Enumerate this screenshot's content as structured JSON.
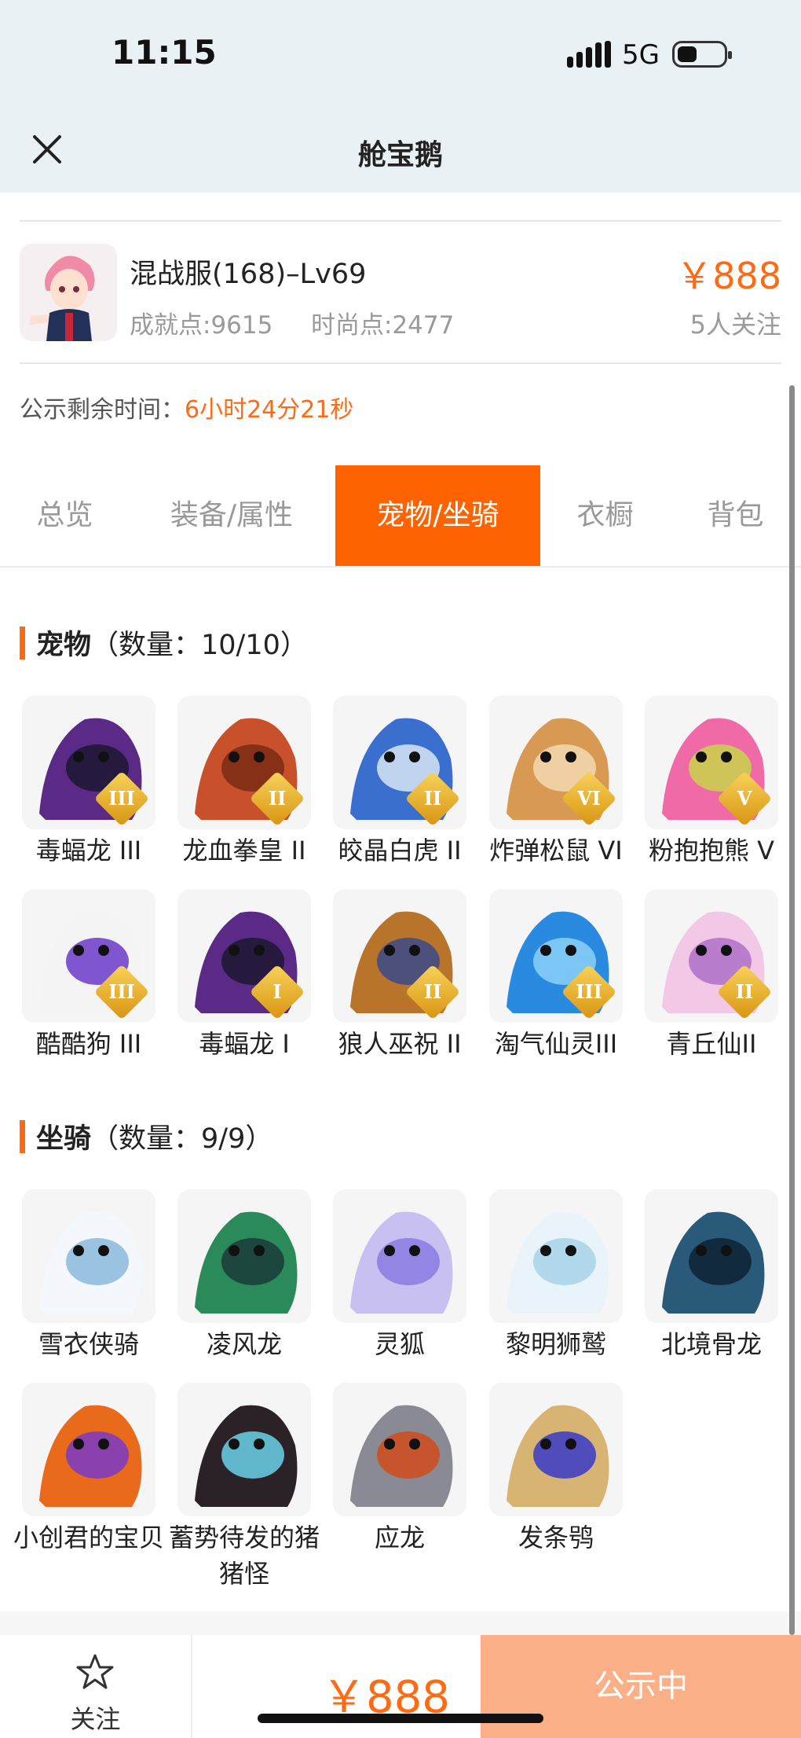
{
  "status_bar": {
    "time": "11:15",
    "network": "5G"
  },
  "nav": {
    "title": "舱宝鹅"
  },
  "listing": {
    "title": "混战服(168)–Lv69",
    "achievement": "成就点:9615",
    "fashion": "时尚点:2477",
    "price": "￥888",
    "followers": "5人关注"
  },
  "countdown": {
    "label": "公示剩余时间：",
    "value": "6小时24分21秒"
  },
  "tabs": [
    {
      "label": "总览"
    },
    {
      "label": "装备/属性"
    },
    {
      "label": "宠物/坐骑",
      "active": true
    },
    {
      "label": "衣橱"
    },
    {
      "label": "背包"
    }
  ],
  "pets_section": {
    "title": "宠物",
    "count": "（数量：10/10）"
  },
  "pets": [
    {
      "name": "毒蝠龙 III",
      "badge": "III",
      "colors": [
        "#5a2a86",
        "#1c1630"
      ]
    },
    {
      "name": "龙血拳皇 II",
      "badge": "II",
      "colors": [
        "#c8502a",
        "#7a2a14"
      ]
    },
    {
      "name": "皎晶白虎 II",
      "badge": "II",
      "colors": [
        "#3a6fd0",
        "#d8e6f6"
      ]
    },
    {
      "name": "炸弹松鼠 VI",
      "badge": "VI",
      "colors": [
        "#d89a52",
        "#f4d9b0"
      ]
    },
    {
      "name": "粉抱抱熊 V",
      "badge": "V",
      "colors": [
        "#f06aa8",
        "#c8d44a"
      ]
    },
    {
      "name": "酷酷狗 III",
      "badge": "III",
      "colors": [
        "#f4f4f4",
        "#6a3ac8"
      ]
    },
    {
      "name": "毒蝠龙 I",
      "badge": "I",
      "colors": [
        "#5a2a86",
        "#1c1630"
      ]
    },
    {
      "name": "狼人巫祝 II",
      "badge": "II",
      "colors": [
        "#b8742a",
        "#3a4a8a"
      ]
    },
    {
      "name": "淘气仙灵III",
      "badge": "III",
      "colors": [
        "#2a8ae0",
        "#8ad0f8"
      ]
    },
    {
      "name": "青丘仙II",
      "badge": "II",
      "colors": [
        "#f2c8e6",
        "#b070c8"
      ]
    }
  ],
  "mounts_section": {
    "title": "坐骑",
    "count": "（数量：9/9）"
  },
  "mounts": [
    {
      "name": "雪衣侠骑",
      "colors": [
        "#f4f8fc",
        "#8ab8dc"
      ]
    },
    {
      "name": "凌风龙",
      "colors": [
        "#2a8a5a",
        "#1a3a3a"
      ]
    },
    {
      "name": "灵狐",
      "colors": [
        "#c8c0f0",
        "#8a7ae0"
      ]
    },
    {
      "name": "黎明狮鹫",
      "colors": [
        "#e8f4fa",
        "#a8d4e8"
      ]
    },
    {
      "name": "北境骨龙",
      "colors": [
        "#2a5a7a",
        "#0e2232"
      ]
    },
    {
      "name": "小创君的宝贝",
      "colors": [
        "#e86a1a",
        "#7a3ac8"
      ]
    },
    {
      "name": "蓄势待发的猪猪怪",
      "colors": [
        "#2a2226",
        "#6ad0e8"
      ]
    },
    {
      "name": "应龙",
      "colors": [
        "#8a8a94",
        "#d04a1a"
      ]
    },
    {
      "name": "发条鸮",
      "colors": [
        "#d8b472",
        "#3a3ac8"
      ]
    }
  ],
  "bottom_bar": {
    "follow_label": "关注",
    "price": "￥888",
    "status_label": "公示中"
  },
  "colors": {
    "accent": "#ff6200",
    "price": "#ff6a12",
    "status_button": "#fbb088"
  }
}
